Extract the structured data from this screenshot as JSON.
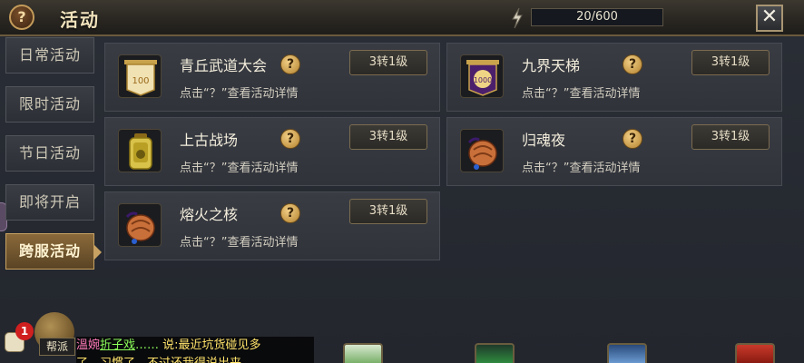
{
  "window": {
    "title": "活动",
    "help_glyph": "?",
    "close_glyph": "✕",
    "energy_value": "20/600"
  },
  "sidebar": {
    "tabs": [
      {
        "label": "日常活动",
        "active": false
      },
      {
        "label": "限时活动",
        "active": false
      },
      {
        "label": "节日活动",
        "active": false
      },
      {
        "label": "即将开启",
        "active": false
      },
      {
        "label": "跨服活动",
        "active": true
      }
    ]
  },
  "activities": [
    {
      "name": "青丘武道大会",
      "level": "3转1级",
      "desc": "点击“？”查看活动详情",
      "icon": "scroll-banner-icon",
      "badge": "100"
    },
    {
      "name": "九界天梯",
      "level": "3转1级",
      "desc": "点击“？”查看活动详情",
      "icon": "ladder-banner-icon",
      "badge": "1000"
    },
    {
      "name": "上古战场",
      "level": "3转1级",
      "desc": "点击“？”查看活动详情",
      "icon": "gold-token-icon",
      "badge": ""
    },
    {
      "name": "归魂夜",
      "level": "3转1级",
      "desc": "点击“？”查看活动详情",
      "icon": "loot-bag-icon",
      "badge": ""
    },
    {
      "name": "熔火之核",
      "level": "3转1级",
      "desc": "点击“？”查看活动详情",
      "icon": "loot-bag-icon",
      "badge": ""
    }
  ],
  "activity_info_glyph": "?",
  "chat": {
    "badge_count": "1",
    "channel_label": "帮派",
    "nick": "溫婉",
    "user": "折子戏",
    "dots": "……",
    "message": "说:最近坑货碰见多",
    "line2": "了，习惯了，不过还我得说出来"
  },
  "colors": {
    "accent_gold": "#c8a263",
    "chat_user": "#8dff5a",
    "chat_message": "#ffe36a",
    "badge_red": "#d01f1f"
  }
}
